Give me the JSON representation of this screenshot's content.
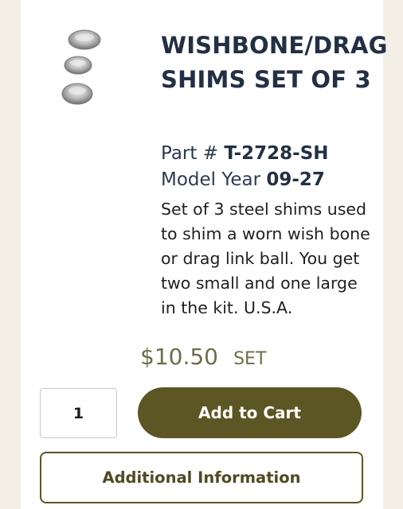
{
  "product": {
    "title": "WISHBONE/DRAG SHIMS SET OF 3",
    "part_label": "Part # ",
    "part_number": "T-2728-SH",
    "year_label": "Model Year ",
    "model_year": "09-27",
    "description": "Set of 3 steel shims used to shim a worn wish bone or drag link ball. You get two small and one large in the kit. U.S.A.",
    "price": "$10.50",
    "unit": "SET",
    "image_icon": "metal-shims-image"
  },
  "cart": {
    "quantity": "1",
    "add_label": "Add to Cart"
  },
  "additional": {
    "label": "Additional Information"
  },
  "colors": {
    "title": "#233044",
    "price": "#6d6e49",
    "button": "#5c5524"
  }
}
